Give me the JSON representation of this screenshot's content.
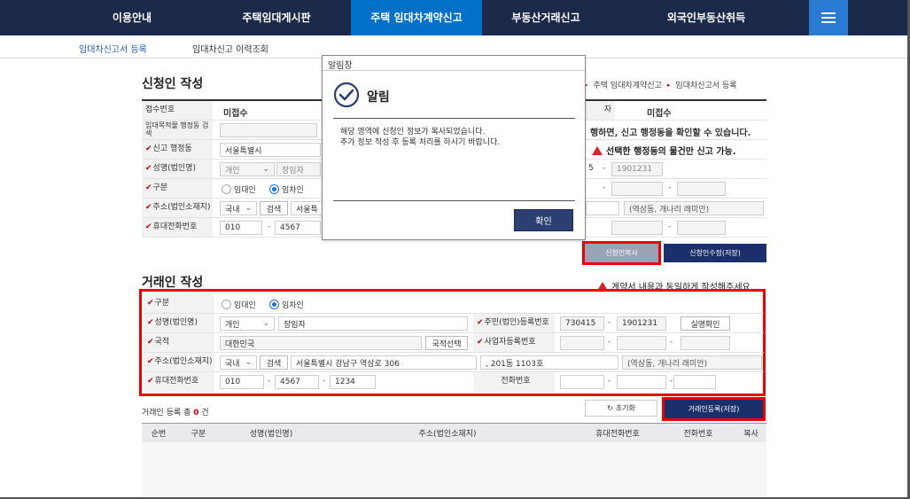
{
  "nav": {
    "items": [
      "이용안내",
      "주택임대게시판",
      "주택 임대차계약신고",
      "부동산거래신고",
      "외국인부동산취득"
    ]
  },
  "subnav": {
    "items": [
      "임대차신고서 등록",
      "임대차신고 이력조회"
    ]
  },
  "breadcrumb": [
    "주택 임대차계약신고",
    "임대차신고서 등록"
  ],
  "applicant": {
    "title": "신청인 작성",
    "rows": {
      "receipt_label": "접수번호",
      "receipt_value": "미접수",
      "receipt_right_label": "자",
      "receipt_right_value": "미접수",
      "search_label": "임대목적물 행정동 검색",
      "search_note": "행하면, 신고 행정동을 확인할 수 있습니다.",
      "admin_label": "신고 행정동",
      "admin_value": "서울특별시",
      "admin_note": "선택한 행정동의 물건만 신고 가능.",
      "name_label": "성명(법인명)",
      "name_type": "개인",
      "name_value": "장임자",
      "id_part1": "5",
      "id_part2": "1901231",
      "type_label": "구분",
      "type_opt1": "임대인",
      "type_opt2": "임차인",
      "addr_label": "주소(법인소재지)",
      "addr_country": "국내",
      "addr_search": "검색",
      "addr_value": "서울특",
      "addr_note": "(역삼동, 개나리 래미안)",
      "phone_label": "휴대전화번호",
      "phone1": "010",
      "phone2": "4567"
    },
    "btn_copy": "신청인복사",
    "btn_save": "신청인수정(저장)"
  },
  "trader": {
    "title": "거래인 작성",
    "notice": "계약서 내용과 동일하게 작성해주세요.",
    "type_label": "구분",
    "type_opt1": "임대인",
    "type_opt2": "임차인",
    "name_label": "성명(법인명)",
    "name_type": "개인",
    "name_value": "장임자",
    "resident_label": "주민(법인)등록번호",
    "resident1": "730415",
    "resident2": "1901231",
    "verify_btn": "실명확인",
    "nation_label": "국적",
    "nation_value": "대한민국",
    "nation_btn": "국적선택",
    "biz_label": "사업자등록번호",
    "addr_label": "주소(법인소재지)",
    "addr_country": "국내",
    "addr_search": "검색",
    "addr_value": "서울특별시 강남구 역삼로 306",
    "addr_detail": ", 201동 1103호",
    "addr_note": "(역삼동, 개나리 래미안)",
    "phone_label": "휴대전화번호",
    "phone1": "010",
    "phone2": "4567",
    "phone3": "1234",
    "tel_label": "전화번호",
    "btn_reset": "초기화",
    "btn_register": "거래인등록(저장)",
    "count_prefix": "거래인 등록 총",
    "count_value": "0",
    "count_suffix": "건"
  },
  "table": {
    "headers": [
      "순번",
      "구분",
      "성명(법인명)",
      "주소(법인소재지)",
      "휴대전화번호",
      "전화번호",
      "복사"
    ]
  },
  "modal": {
    "title": "알림창",
    "heading": "알림",
    "line1": "해당 영역에 신청인 정보가 복사되었습니다.",
    "line2": "추가 정보 작성 후 등록 처리를 하시기 바랍니다.",
    "ok": "확인"
  },
  "colors": {
    "nav_bg": "#1b2a4a",
    "nav_active": "#0070c9",
    "highlight": "#e00000",
    "navy_button": "#1b2f6a",
    "radio_on": "#1f6fd6"
  }
}
